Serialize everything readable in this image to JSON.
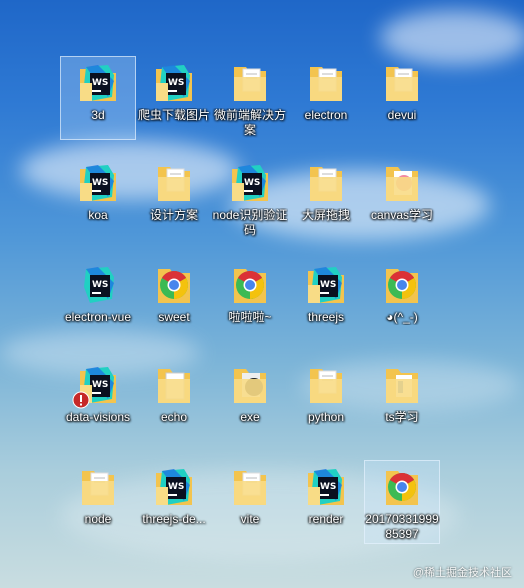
{
  "desktop": {
    "icons": [
      {
        "label": "3d",
        "type": "ws-folder",
        "selected": true
      },
      {
        "label": "爬虫下载图片",
        "type": "ws-folder"
      },
      {
        "label": "微前端解决方案",
        "type": "folder"
      },
      {
        "label": "electron",
        "type": "folder"
      },
      {
        "label": "devui",
        "type": "folder"
      },
      {
        "label": "koa",
        "type": "ws-folder"
      },
      {
        "label": "设计方案",
        "type": "folder"
      },
      {
        "label": "node识别验证码",
        "type": "ws-folder"
      },
      {
        "label": "大屏拖拽",
        "type": "folder"
      },
      {
        "label": "canvas学习",
        "type": "folder-pink"
      },
      {
        "label": "electron-vue",
        "type": "ws-app"
      },
      {
        "label": "sweet",
        "type": "chrome-folder"
      },
      {
        "label": "啦啦啦~",
        "type": "chrome-folder"
      },
      {
        "label": "threejs",
        "type": "ws-folder"
      },
      {
        "label": "◕(^_-)",
        "type": "chrome-folder"
      },
      {
        "label": "data-visions",
        "type": "ws-folder-error"
      },
      {
        "label": "echo",
        "type": "folder-white"
      },
      {
        "label": "exe",
        "type": "folder-dark"
      },
      {
        "label": "python",
        "type": "folder"
      },
      {
        "label": "ts学习",
        "type": "folder-blue"
      },
      {
        "label": "node",
        "type": "folder"
      },
      {
        "label": "threejs-de...",
        "type": "ws-folder"
      },
      {
        "label": "vite",
        "type": "folder"
      },
      {
        "label": "render",
        "type": "ws-folder"
      },
      {
        "label": "2017033199985397",
        "type": "chrome-folder",
        "selected": true
      }
    ],
    "watermark": "@稀土掘金技术社区"
  },
  "colors": {
    "folder": "#f3c44e",
    "folder_light": "#f8dc86",
    "ws_dark": "#0a1020",
    "ws_teal": "#21d0c3",
    "ws_blue": "#1d7be0",
    "chrome_red": "#db3236",
    "chrome_yellow": "#f4c20d",
    "chrome_green": "#3cba54",
    "chrome_blue": "#4885ed",
    "error_red": "#c62828"
  }
}
